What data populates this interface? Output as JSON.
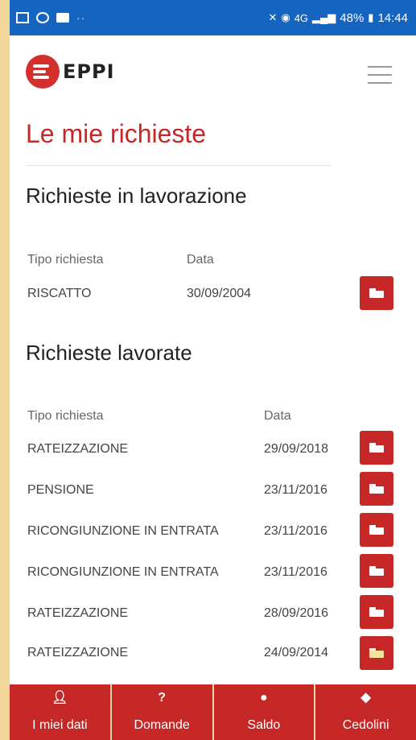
{
  "status_bar": {
    "icons": [
      "image-icon",
      "circle-icon",
      "message-icon",
      "more-dots-icon"
    ],
    "right_text": "48%",
    "network": "4G",
    "time": "14:44"
  },
  "header": {
    "logo_text": "EPPI",
    "menu_icon": "hamburger-icon"
  },
  "page": {
    "title": "Le mie richieste"
  },
  "in_progress": {
    "title": "Richieste in lavorazione",
    "col_type": "Tipo richiesta",
    "col_date": "Data",
    "rows": [
      {
        "type": "RISCATTO",
        "date": "30/09/2004"
      }
    ]
  },
  "completed": {
    "title": "Richieste lavorate",
    "col_type": "Tipo richiesta",
    "col_date": "Data",
    "rows": [
      {
        "type": "RATEIZZAZIONE",
        "date": "29/09/2018"
      },
      {
        "type": "PENSIONE",
        "date": "23/11/2016"
      },
      {
        "type": "RICONGIUNZIONE IN ENTRATA",
        "date": "23/11/2016"
      },
      {
        "type": "RICONGIUNZIONE IN ENTRATA",
        "date": "23/11/2016"
      },
      {
        "type": "RATEIZZAZIONE",
        "date": "28/09/2016"
      },
      {
        "type": "RATEIZZAZIONE",
        "date": "24/09/2014"
      }
    ]
  },
  "tabs": [
    {
      "label": "I miei dati",
      "icon": "user-icon"
    },
    {
      "label": "Domande",
      "icon": "question-icon"
    },
    {
      "label": "Saldo",
      "icon": "map-marker-icon"
    },
    {
      "label": "Cedolini",
      "icon": "piggy-bank-icon"
    }
  ],
  "colors": {
    "accent": "#c62828",
    "status_bar": "#1565c0",
    "frame": "#f3d79a"
  }
}
